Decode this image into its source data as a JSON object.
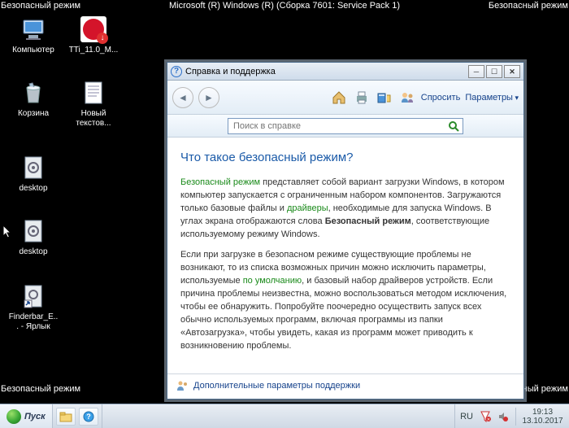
{
  "safemode_label": "Безопасный режим",
  "os_title": "Microsoft (R) Windows (R) (Сборка 7601: Service Pack 1)",
  "icons": {
    "computer": "Компьютер",
    "trend": "TTi_11.0_M...",
    "recycle": "Корзина",
    "textdoc": "Новый текстов...",
    "desktop1": "desktop",
    "desktop2": "desktop",
    "finderbar": "Finderbar_E... - Ярлык"
  },
  "help": {
    "title": "Справка и поддержка",
    "ask": "Спросить",
    "params": "Параметры",
    "search_placeholder": "Поиск в справке",
    "heading": "Что такое безопасный режим?",
    "p1_a": "Безопасный режим",
    "p1_b": " представляет собой вариант загрузки Windows, в котором компьютер запускается с ограниченным набором компонентов. Загружаются только базовые файлы и ",
    "p1_c": "драйверы",
    "p1_d": ", необходимые для запуска Windows. В углах экрана отображаются слова ",
    "p1_e": "Безопасный режим",
    "p1_f": ", соответствующие используемому режиму Windows.",
    "p2_a": "Если при загрузке в безопасном режиме существующие проблемы не возникают, то из списка возможных причин можно исключить параметры, используемые ",
    "p2_b": "по умолчанию",
    "p2_c": ", и базовый набор драйверов устройств. Если причина проблемы неизвестна, можно воспользоваться методом исключения, чтобы ее обнаружить. Попробуйте поочередно осуществить запуск всех обычно используемых программ, включая программы из папки «Автозагрузка», чтобы увидеть, какая из программ может приводить к возникновению проблемы.",
    "support_more": "Дополнительные параметры поддержки"
  },
  "taskbar": {
    "start": "Пуск",
    "lang": "RU",
    "time": "19:13",
    "date": "13.10.2017"
  }
}
